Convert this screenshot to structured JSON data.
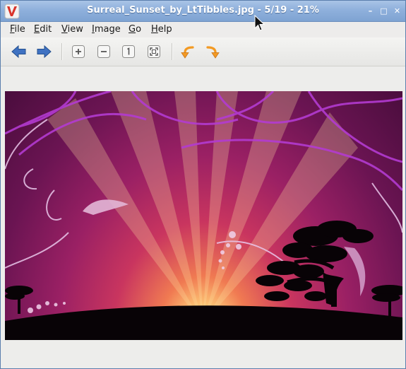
{
  "window": {
    "title": "Surreal_Sunset_by_LtTibbles.jpg - 5/19 - 21%",
    "minimize_glyph": "–",
    "maximize_glyph": "□",
    "close_glyph": "✕"
  },
  "menu": {
    "items": [
      {
        "mnemonic": "F",
        "rest": "ile"
      },
      {
        "mnemonic": "E",
        "rest": "dit"
      },
      {
        "mnemonic": "V",
        "rest": "iew"
      },
      {
        "mnemonic": "I",
        "rest": "mage"
      },
      {
        "mnemonic": "G",
        "rest": "o"
      },
      {
        "mnemonic": "H",
        "rest": "elp"
      }
    ]
  },
  "toolbar": {
    "buttons": [
      "back-arrow-icon",
      "forward-arrow-icon",
      "zoom-in-icon",
      "zoom-out-icon",
      "zoom-normal-icon",
      "zoom-fit-icon",
      "rotate-left-icon",
      "rotate-right-icon"
    ]
  },
  "colors": {
    "title_bar": "#8fb0dc",
    "arrow_blue": "#3f72c2",
    "rotate_orange": "#f39a23",
    "sunset_magenta": "#9a2064"
  },
  "image": {
    "subject": "Surreal sunset wallpaper"
  }
}
